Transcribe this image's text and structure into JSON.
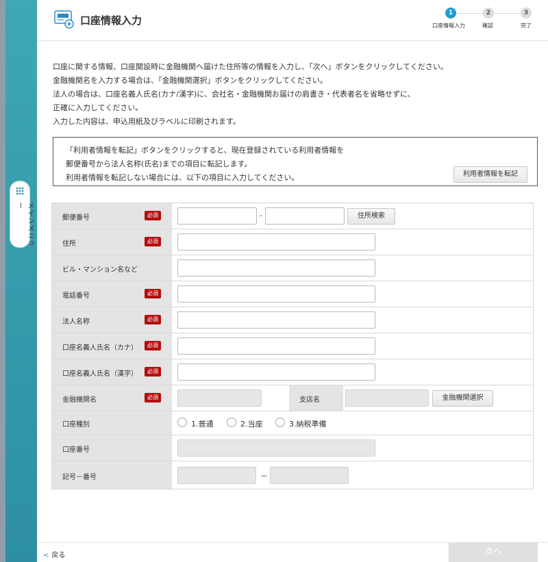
{
  "side_menu": {
    "label": "メインメニュー"
  },
  "header": {
    "title": "口座情報入力",
    "steps": [
      {
        "num": "1",
        "label": "口座情報入力"
      },
      {
        "num": "2",
        "label": "確認"
      },
      {
        "num": "3",
        "label": "完了"
      }
    ]
  },
  "instructions": [
    "口座に関する情報、口座開設時に金融機関へ届けた住所等の情報を入力し、「次へ」ボタンをクリックしてください。",
    "金融機関名を入力する場合は、「金融機関選択」ボタンをクリックしてください。",
    "法人の場合は、口座名義人氏名(カナ/漢字)に、会社名・金融機関お届けの肩書き・代表者名を省略せずに、",
    "正確に入力してください。",
    "入力した内容は、申込用紙及びラベルに印刷されます。"
  ],
  "info_box": {
    "lines": [
      "「利用者情報を転記」ボタンをクリックすると、現在登録されている利用者情報を",
      "郵便番号から法人名称(氏名)までの項目に転記します。",
      "利用者情報を転記しない場合には、以下の項目に入力してください。"
    ],
    "button": "利用者情報を転記"
  },
  "form": {
    "required_badge": "必須",
    "postal_code": {
      "label": "郵便番号",
      "separator": "-",
      "search_button": "住所検索"
    },
    "address": {
      "label": "住所"
    },
    "building": {
      "label": "ビル・マンション名など"
    },
    "phone": {
      "label": "電話番号"
    },
    "corporate_name": {
      "label": "法人名称"
    },
    "holder_kana": {
      "label": "口座名義人氏名（カナ）"
    },
    "holder_kanji": {
      "label": "口座名義人氏名（漢字）"
    },
    "bank": {
      "label": "金融機関名",
      "branch_label": "支店名",
      "select_button": "金融機関選択"
    },
    "account_type": {
      "label": "口座種別",
      "options": [
        "1.普通",
        "2.当座",
        "3.納税準備"
      ]
    },
    "account_number": {
      "label": "口座番号"
    },
    "symbol_number": {
      "label": "記号－番号",
      "separator": "－"
    }
  },
  "footer": {
    "back": "戻る",
    "next": "次へ"
  },
  "colors": {
    "accent": "#1f9cd0",
    "required": "#b40e0e",
    "sidebar": "#3fa7b5"
  }
}
